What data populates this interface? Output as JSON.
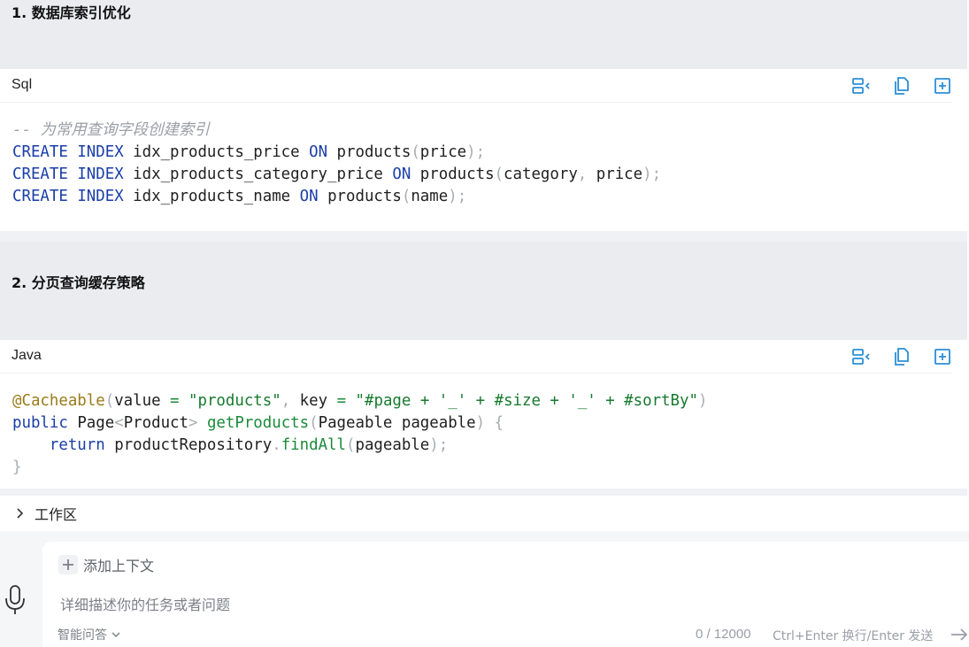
{
  "sections": [
    {
      "title": "1. 数据库索引优化",
      "lang": "Sql"
    },
    {
      "title": "2. 分页查询缓存策略",
      "lang": "Java"
    }
  ],
  "sql_code": {
    "comment": "-- 为常用查询字段创建索引",
    "line1": {
      "kw1": "CREATE",
      "kw2": "INDEX",
      "name": "idx_products_price",
      "on": "ON",
      "table": "products",
      "args": "price"
    },
    "line2": {
      "kw1": "CREATE",
      "kw2": "INDEX",
      "name": "idx_products_category_price",
      "on": "ON",
      "table": "products",
      "arg1": "category",
      "arg2": "price"
    },
    "line3": {
      "kw1": "CREATE",
      "kw2": "INDEX",
      "name": "idx_products_name",
      "on": "ON",
      "table": "products",
      "args": "name"
    }
  },
  "java_code": {
    "annotation": "@Cacheable",
    "value_key": "value",
    "value_str": "\"products\"",
    "key_key": "key",
    "key_str": "\"#page + '_' + #size + '_' + #sortBy\"",
    "public": "public",
    "type": "Page",
    "generic": "Product",
    "method": "getProducts",
    "param_type": "Pageable",
    "param_name": "pageable",
    "return": "return",
    "repo": "productRepository",
    "call": "findAll",
    "call_arg": "pageable"
  },
  "workspace": {
    "label": "工作区"
  },
  "composer": {
    "add_context": "添加上下文",
    "placeholder": "详细描述你的任务或者问题",
    "mode": "智能问答",
    "counter": "0 / 12000",
    "hint": "Ctrl+Enter 换行/Enter 发送"
  },
  "icons": [
    "collapse-code-icon",
    "copy-icon",
    "insert-icon",
    "chevron-right-icon",
    "microphone-icon",
    "plus-icon",
    "chevron-down-icon",
    "send-arrow-icon"
  ],
  "colors": {
    "accent": "#2b8fd6",
    "keyword": "#1a3ea8",
    "string": "#177a2e",
    "comment": "#9a9ea6"
  }
}
